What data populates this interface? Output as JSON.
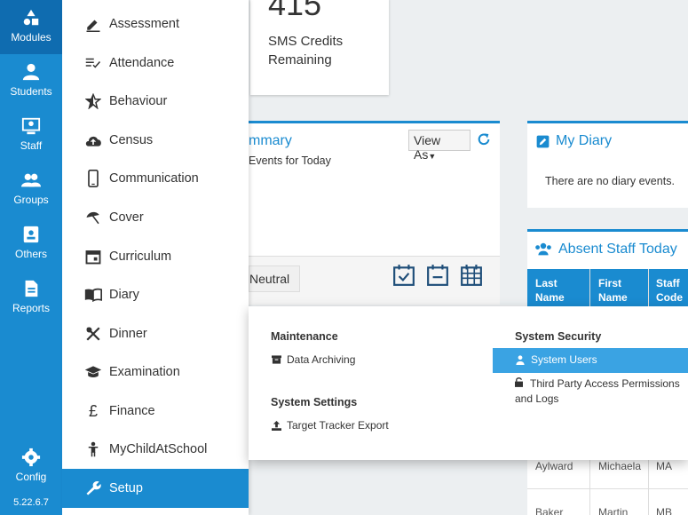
{
  "rail": {
    "items": [
      {
        "label": "Modules",
        "icon": "modules-icon"
      },
      {
        "label": "Students",
        "icon": "students-icon"
      },
      {
        "label": "Staff",
        "icon": "staff-icon"
      },
      {
        "label": "Groups",
        "icon": "groups-icon"
      },
      {
        "label": "Others",
        "icon": "others-icon"
      },
      {
        "label": "Reports",
        "icon": "reports-icon"
      }
    ],
    "config_label": "Config",
    "version": "5.22.6.7"
  },
  "menu": {
    "items": [
      {
        "label": "Assessment"
      },
      {
        "label": "Attendance"
      },
      {
        "label": "Behaviour"
      },
      {
        "label": "Census"
      },
      {
        "label": "Communication"
      },
      {
        "label": "Cover"
      },
      {
        "label": "Curriculum"
      },
      {
        "label": "Diary"
      },
      {
        "label": "Dinner"
      },
      {
        "label": "Examination"
      },
      {
        "label": "Finance"
      },
      {
        "label": "MyChildAtSchool"
      },
      {
        "label": "Setup"
      }
    ]
  },
  "sms": {
    "count": "415",
    "label_line1": "SMS Credits",
    "label_line2": "Remaining"
  },
  "summary": {
    "title": "mmary",
    "view_as": "View As",
    "events": "Events for Today",
    "neutral": "Neutral"
  },
  "diary": {
    "title": "My Diary",
    "empty": "There are no diary events."
  },
  "absent": {
    "title": "Absent Staff Today",
    "headers": [
      {
        "line1": "Last",
        "line2": "Name"
      },
      {
        "line1": "First",
        "line2": "Name"
      },
      {
        "line1": "Staff",
        "line2": "Code"
      }
    ],
    "rows": [
      {
        "last": "Aylward",
        "first": "Michaela",
        "code": "MA"
      },
      {
        "last": "Baker",
        "first": "Martin",
        "code": "MB"
      }
    ]
  },
  "dropdown": {
    "maintenance": {
      "heading": "Maintenance",
      "items": [
        "Data Archiving"
      ]
    },
    "settings": {
      "heading": "System Settings",
      "items": [
        "Target Tracker Export"
      ]
    },
    "security": {
      "heading": "System Security",
      "items": [
        "System Users",
        "Third Party Access Permissions",
        "and Logs"
      ]
    }
  },
  "colors": {
    "accent": "#1a8bd0",
    "rail_active": "#0f6cb0",
    "highlight": "#3aa3e3"
  }
}
